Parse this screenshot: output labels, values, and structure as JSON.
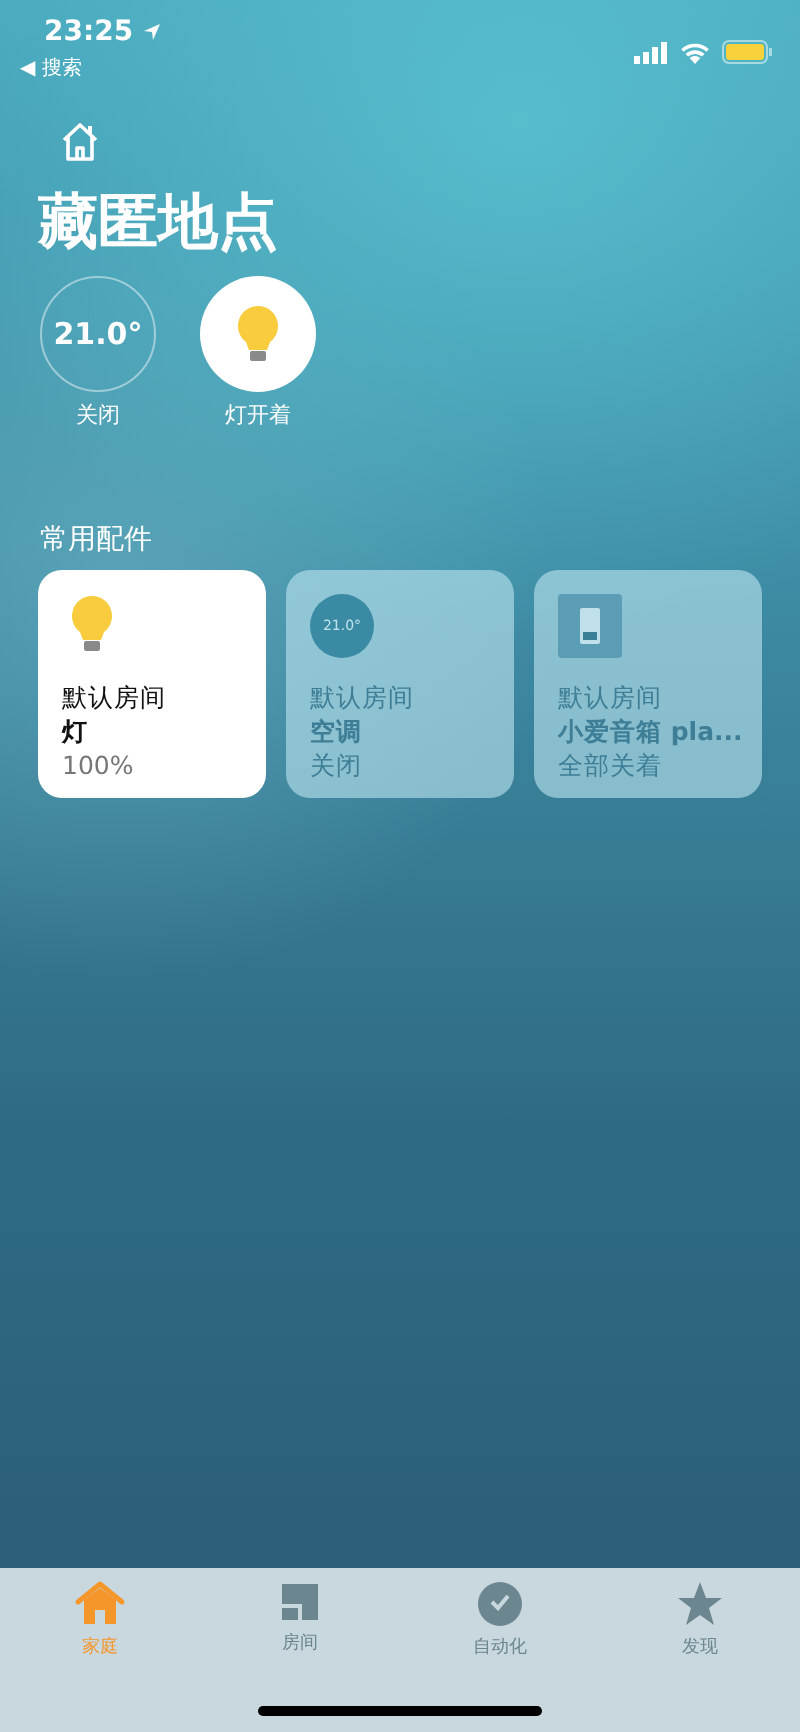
{
  "status_bar": {
    "time": "23:25",
    "back": "◀ 搜索"
  },
  "title": "藏匿地点",
  "summary": [
    {
      "kind": "thermostat",
      "value": "21.0°",
      "label": "关闭",
      "on": false
    },
    {
      "kind": "light",
      "label": "灯开着",
      "on": true
    }
  ],
  "favorites": {
    "title": "常用配件",
    "accessories": [
      {
        "kind": "light",
        "room": "默认房间",
        "name": "灯",
        "status": "100%",
        "on": true
      },
      {
        "kind": "thermostat",
        "badge": "21.0°",
        "room": "默认房间",
        "name": "空调",
        "status": "关闭",
        "on": false
      },
      {
        "kind": "switch",
        "room": "默认房间",
        "name": "小爱音箱 pla...",
        "status": "全部关着",
        "on": false
      }
    ]
  },
  "tabs": [
    {
      "kind": "home",
      "label": "家庭",
      "selected": true
    },
    {
      "kind": "rooms",
      "label": "房间",
      "selected": false
    },
    {
      "kind": "automation",
      "label": "自动化",
      "selected": false
    },
    {
      "kind": "discover",
      "label": "发现",
      "selected": false
    }
  ]
}
